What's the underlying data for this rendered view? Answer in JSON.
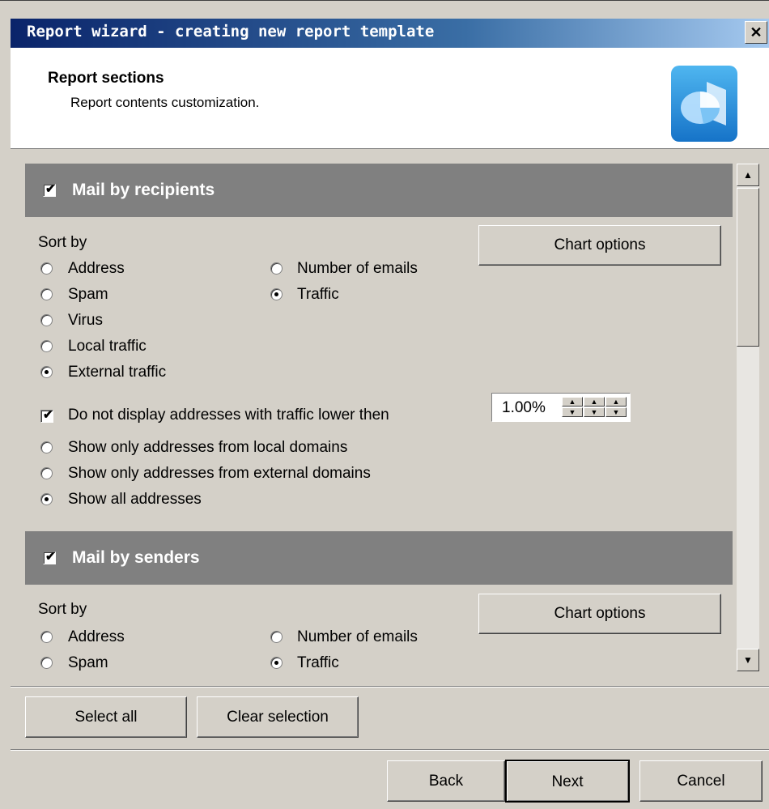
{
  "window": {
    "title": "Report wizard - creating new report template",
    "close_symbol": "✕"
  },
  "header": {
    "title": "Report sections",
    "subtitle": "Report contents customization.",
    "icon": "pie-chart-report-icon"
  },
  "recipients": {
    "title": "Mail by recipients",
    "checked": true,
    "sort_by_label": "Sort by",
    "chart_button": "Chart options",
    "sort_left": [
      "Address",
      "Spam",
      "Virus",
      "Local traffic",
      "External traffic"
    ],
    "sort_right": [
      "Number of emails",
      "Traffic"
    ],
    "selected_left": "External traffic",
    "selected_right": "Traffic",
    "threshold_label": "Do not display addresses with traffic lower then",
    "threshold_checked": true,
    "threshold_value": "1.00%",
    "address_options": [
      "Show only addresses from local domains",
      "Show only addresses from external domains",
      "Show all addresses"
    ],
    "address_selected": "Show all addresses"
  },
  "senders": {
    "title": "Mail by senders",
    "checked": true,
    "sort_by_label": "Sort by",
    "chart_button": "Chart options",
    "sort_left": [
      "Address",
      "Spam"
    ],
    "sort_right": [
      "Number of emails",
      "Traffic"
    ],
    "selected_right": "Traffic"
  },
  "actions": {
    "select_all": "Select all",
    "clear_selection": "Clear selection"
  },
  "footer": {
    "back": "Back",
    "next": "Next",
    "cancel": "Cancel"
  },
  "colors": {
    "titlebar_start": "#0a246a",
    "titlebar_end": "#a6caf0",
    "section_header": "#808080",
    "dialog_face": "#d4d0c8"
  }
}
